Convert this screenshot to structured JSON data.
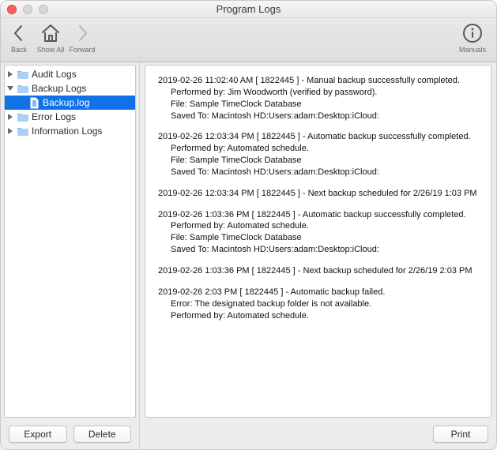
{
  "window": {
    "title": "Program Logs"
  },
  "toolbar": {
    "back": {
      "label": "Back"
    },
    "showall": {
      "label": "Show All"
    },
    "forward": {
      "label": "Forward"
    },
    "manuals": {
      "label": "Manuals"
    }
  },
  "sidebar": {
    "nodes": {
      "audit": {
        "label": "Audit Logs"
      },
      "backup": {
        "label": "Backup Logs"
      },
      "backuplogfile": {
        "label": "Backup.log"
      },
      "error": {
        "label": "Error Logs"
      },
      "info": {
        "label": "Information Logs"
      }
    },
    "buttons": {
      "export": "Export",
      "delete": "Delete"
    }
  },
  "log": {
    "entries": [
      {
        "header": "2019-02-26 11:02:40 AM [ 1822445 ] - Manual backup successfully completed.",
        "lines": [
          "Performed by: Jim Woodworth (verified by password).",
          "File: Sample TimeClock Database",
          "Saved To: Macintosh HD:Users:adam:Desktop:iCloud:"
        ]
      },
      {
        "header": "2019-02-26 12:03:34 PM [ 1822445 ] - Automatic backup successfully completed.",
        "lines": [
          "Performed by:  Automated schedule.",
          "File: Sample TimeClock Database",
          "Saved To: Macintosh HD:Users:adam:Desktop:iCloud:"
        ]
      },
      {
        "header": "2019-02-26 12:03:34 PM [ 1822445 ] - Next backup scheduled for 2/26/19 1:03 PM",
        "lines": []
      },
      {
        "header": "2019-02-26  1:03:36 PM [ 1822445 ] - Automatic backup successfully completed.",
        "lines": [
          "Performed by:  Automated schedule.",
          "File: Sample TimeClock Database",
          "Saved To: Macintosh HD:Users:adam:Desktop:iCloud:"
        ]
      },
      {
        "header": "2019-02-26 1:03:36 PM [ 1822445 ] - Next backup scheduled for 2/26/19 2:03 PM",
        "lines": []
      },
      {
        "header": "2019-02-26 2:03 PM [ 1822445 ] - Automatic backup failed.",
        "lines": [
          "Error: The designated backup folder is not available.",
          "Performed by:  Automated schedule."
        ]
      }
    ]
  },
  "main": {
    "buttons": {
      "print": "Print"
    }
  }
}
